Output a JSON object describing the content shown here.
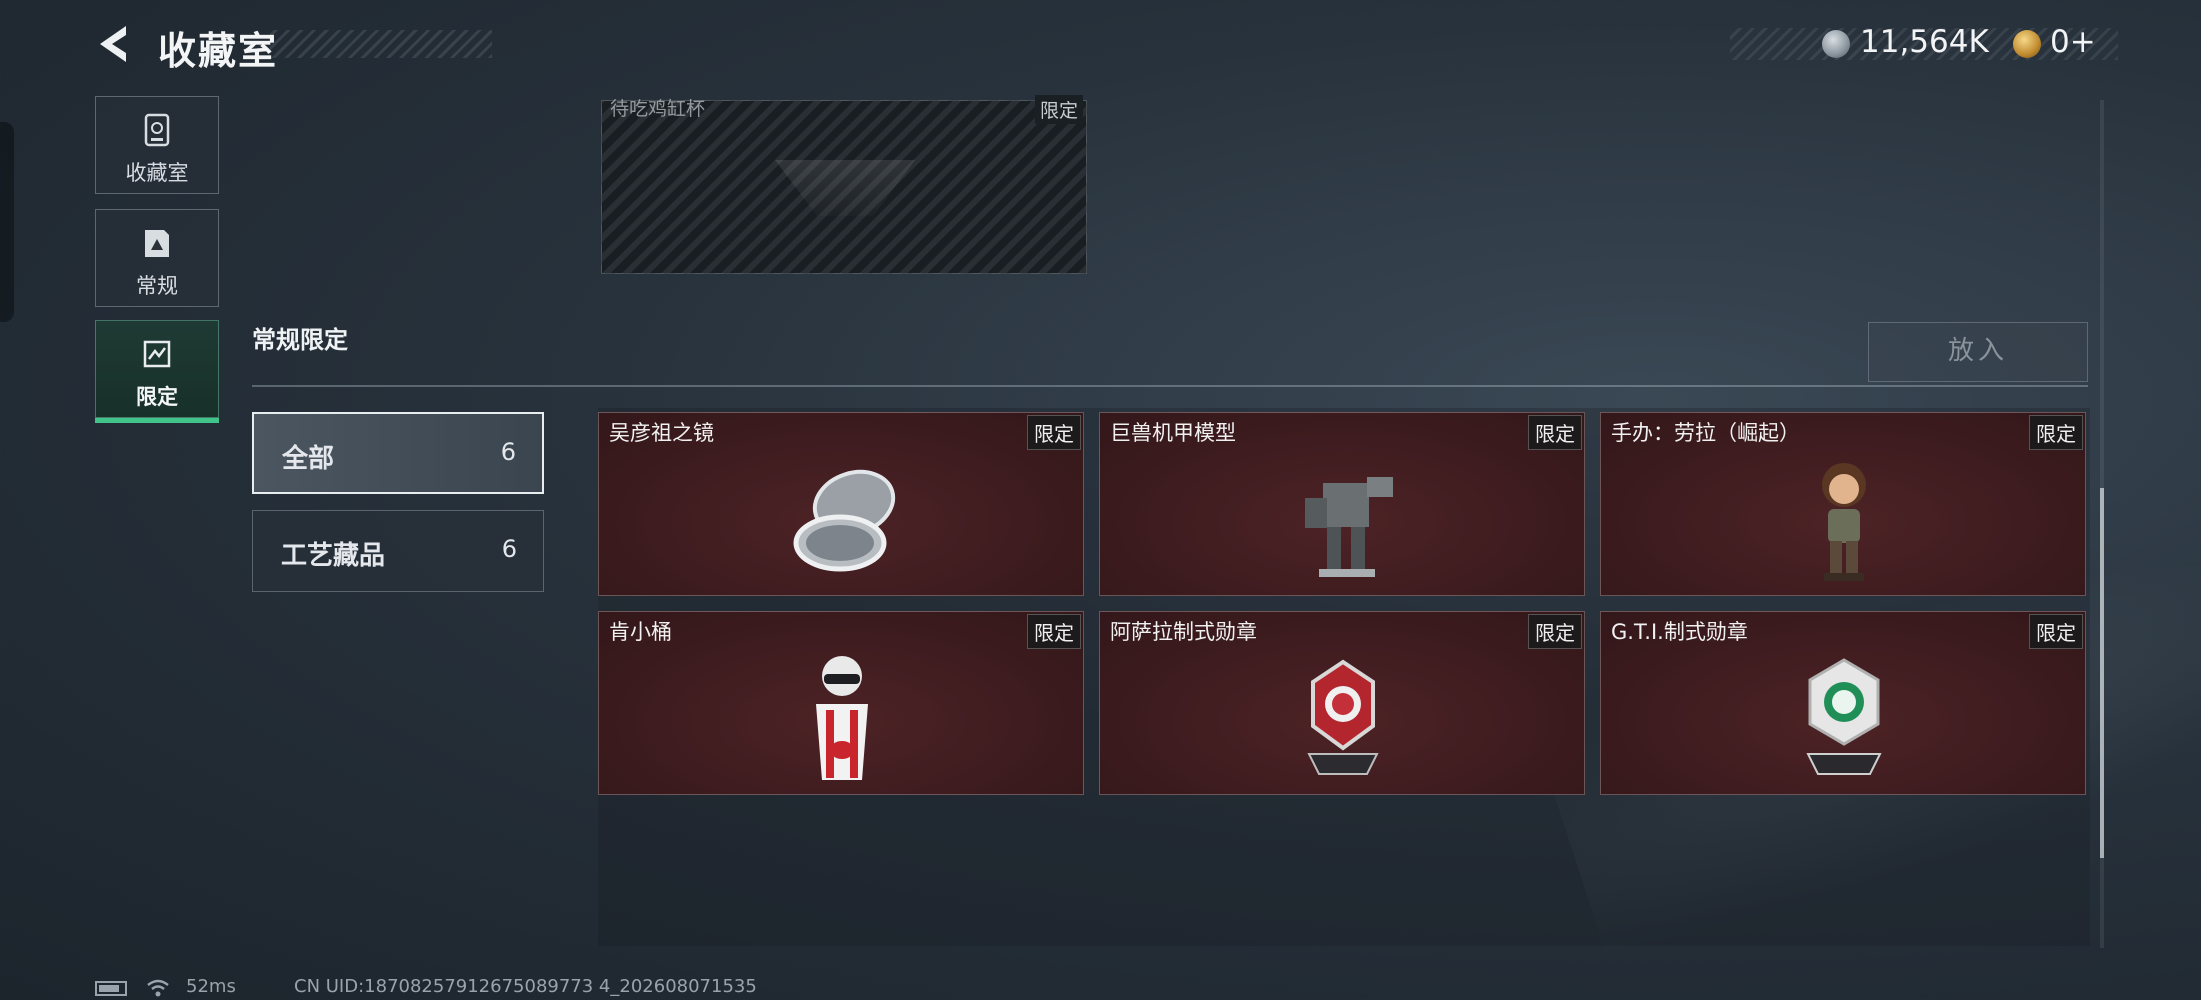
{
  "header": {
    "title": "收藏室",
    "currencies": [
      {
        "icon": "silver-coin-icon",
        "value": "11,564K"
      },
      {
        "icon": "gold-coin-icon",
        "value": "0+"
      }
    ]
  },
  "sidebar": {
    "items": [
      {
        "label": "收藏室",
        "icon": "collection-room-icon",
        "active": false
      },
      {
        "label": "常规",
        "icon": "regular-icon",
        "active": false
      },
      {
        "label": "限定",
        "icon": "limited-icon",
        "active": true
      }
    ]
  },
  "top_card": {
    "name": "待吃鸡缸杯",
    "tag": "限定"
  },
  "section": {
    "title": "常规限定",
    "put_button": "放入"
  },
  "filters": [
    {
      "label": "全部",
      "count": "6",
      "active": true
    },
    {
      "label": "工艺藏品",
      "count": "6",
      "active": false
    }
  ],
  "items": [
    {
      "name": "吴彦祖之镜",
      "tag": "限定",
      "icon": "mirror-icon"
    },
    {
      "name": "巨兽机甲模型",
      "tag": "限定",
      "icon": "mech-model-icon"
    },
    {
      "name": "手办：劳拉（崛起）",
      "tag": "限定",
      "icon": "figure-icon"
    },
    {
      "name": "肯小桶",
      "tag": "限定",
      "icon": "kfc-bucket-icon"
    },
    {
      "name": "阿萨拉制式勋章",
      "tag": "限定",
      "icon": "red-medal-icon"
    },
    {
      "name": "G.T.I.制式勋章",
      "tag": "限定",
      "icon": "green-medal-icon"
    }
  ],
  "status": {
    "ping": "52ms",
    "uid": "CN UID:18708257912675089773 4_202608071535"
  },
  "colors": {
    "accent": "#41c48a",
    "card_bg": "#3a1a1d"
  }
}
